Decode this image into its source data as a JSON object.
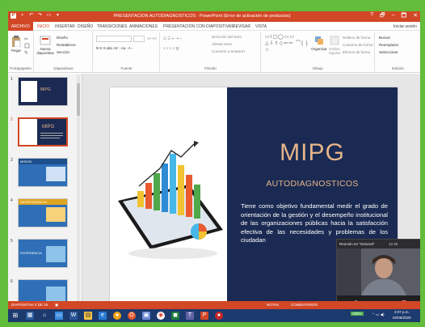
{
  "window": {
    "title": "PRESENTACION AUTODIAGNOSTICOS - PowerPoint (Error de activación de productos)",
    "controls": [
      "?",
      "🗗",
      "–",
      "🗖",
      "✕"
    ]
  },
  "tabs": {
    "file": "ARCHIVO",
    "items": [
      "INICIO",
      "INSERTAR",
      "DISEÑO",
      "TRANSICIONES",
      "ANIMACIONES",
      "PRESENTACIÓN CON DIAPOSITIVAS",
      "REVISAR",
      "VISTA"
    ],
    "signin": "Iniciar sesión"
  },
  "ribbon": {
    "clipboard": {
      "paste": "Pegar",
      "label": "Portapapeles"
    },
    "slides": {
      "new_slide": "Nueva diapositiva",
      "layout": "Diseño",
      "reset": "Restablecer",
      "section": "Sección",
      "label": "Diapositivas"
    },
    "font": {
      "label": "Fuente",
      "row2": "N K S abc AV - Aa - A -"
    },
    "paragraph": {
      "label": "Párrafo",
      "text_direction": "Dirección del texto",
      "align_text": "Alinear texto",
      "smartart": "Convertir a SmartArt"
    },
    "drawing": {
      "arrange": "Organizar",
      "styles": "Estilos rápidos",
      "fill": "Relleno de forma",
      "outline": "Contorno de forma",
      "effects": "Efectos de forma",
      "label": "Dibujo",
      "shapes": "▭\\▢◯▭▭ △⇩⇧◇⇦⇨ ⌒{ }☆"
    },
    "editing": {
      "find": "Buscar",
      "replace": "Reemplazar",
      "select": "Seleccionar",
      "label": "Edición"
    }
  },
  "slide_panel": {
    "numbers": [
      "1",
      "2",
      "3",
      "4",
      "5",
      "6"
    ],
    "selected": 2,
    "thumb_titles": [
      "MIPG",
      "MIPG",
      "MISION",
      "INDEPENDENCIA",
      "EXPERIENCIA",
      ""
    ]
  },
  "slide": {
    "title": "MIPG",
    "subtitle": "AUTODIAGNOSTICOS",
    "body": "Tiene como objetivo fundamental medir el grado de orientación de la gestión y el desempeño institucional de las organizaciones públicas hacia la satisfacción efectiva de las necesidades y problemas de los ciudadan"
  },
  "call": {
    "title": "Reunión en \"General\"",
    "time": "12:48"
  },
  "status": {
    "slide": "DIAPOSITIVA 2 DE 15",
    "notes": "NOTAS",
    "comments": "COMENTARIOS"
  },
  "taskbar": {
    "time": "2:07 p.m.",
    "date": "02/06/2020",
    "battery": "100%"
  },
  "colors": {
    "accent": "#d24726",
    "slide_bg": "#1a2a52",
    "slide_title": "#e6b48a",
    "frame": "#61bd3a",
    "taskbar": "#1c3a6e"
  }
}
